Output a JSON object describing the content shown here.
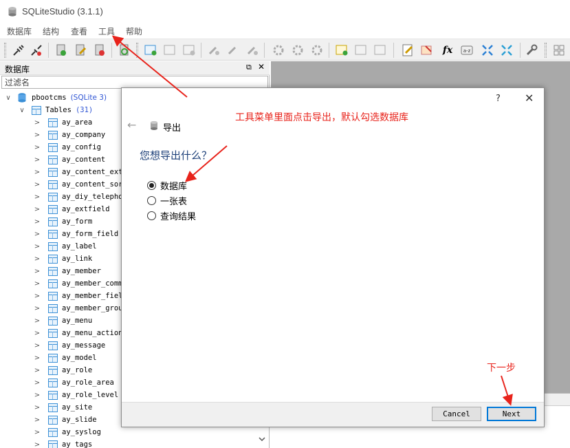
{
  "window": {
    "title": "SQLiteStudio (3.1.1)"
  },
  "menu": [
    "数据库",
    "结构",
    "查看",
    "工具",
    "帮助"
  ],
  "db_panel": {
    "title": "数据库",
    "float_glyph": "⧉",
    "close_glyph": "✕",
    "filter_placeholder": "过滤名",
    "database": {
      "name": "pbootcms",
      "type": "(SQLite 3)"
    },
    "tables_node": {
      "label": "Tables",
      "count": "(31)"
    },
    "tables": [
      "ay_area",
      "ay_company",
      "ay_config",
      "ay_content",
      "ay_content_ext",
      "ay_content_sort",
      "ay_diy_telephone",
      "ay_extfield",
      "ay_form",
      "ay_form_field",
      "ay_label",
      "ay_link",
      "ay_member",
      "ay_member_comment",
      "ay_member_field",
      "ay_member_group",
      "ay_menu",
      "ay_menu_action",
      "ay_message",
      "ay_model",
      "ay_role",
      "ay_role_area",
      "ay_role_level",
      "ay_site",
      "ay_slide",
      "ay_syslog",
      "ay_tags"
    ]
  },
  "dialog": {
    "help_glyph": "?",
    "close_glyph": "✕",
    "back_glyph": "←",
    "title": "导出",
    "question": "您想导出什么？",
    "options": [
      {
        "label": "数据库",
        "checked": true
      },
      {
        "label": "一张表",
        "checked": false
      },
      {
        "label": "查询结果",
        "checked": false
      }
    ],
    "cancel_label": "Cancel",
    "next_label": "Next"
  },
  "annotations": {
    "tools_note": "工具菜单里面点击导出，默认勾选数据库",
    "next_note": "下一步"
  },
  "colors": {
    "annotation": "#e8231b",
    "accent": "#0078d7",
    "question": "#1c3f78"
  }
}
